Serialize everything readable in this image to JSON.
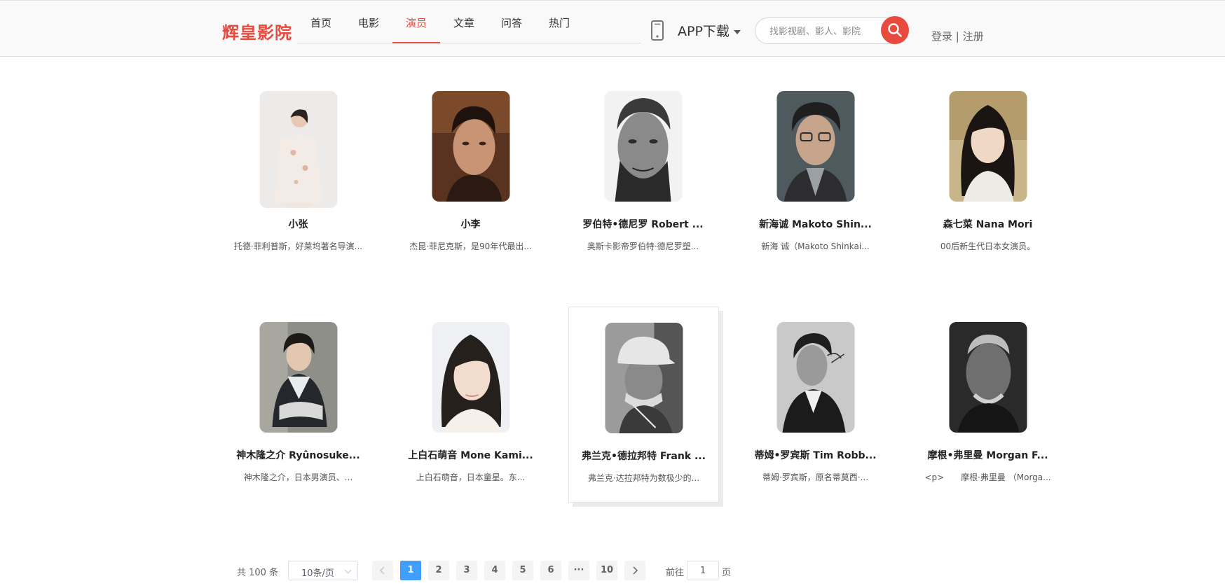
{
  "header": {
    "logo": "辉皇影院",
    "nav": [
      {
        "label": "首页",
        "active": false
      },
      {
        "label": "电影",
        "active": false
      },
      {
        "label": "演员",
        "active": true
      },
      {
        "label": "文章",
        "active": false
      },
      {
        "label": "问答",
        "active": false
      },
      {
        "label": "热门",
        "active": false
      }
    ],
    "app_download": "APP下载",
    "search_placeholder": "找影视剧、影人、影院",
    "login": "登录",
    "separator": "|",
    "register": "注册",
    "icons": {
      "phone": "phone-icon",
      "search": "search-icon",
      "dropdown": "caret-down-icon"
    },
    "accent_color": "#e84a3e"
  },
  "actors": [
    {
      "name": "小张",
      "desc": "托德·菲利普斯，好莱坞著名导演..."
    },
    {
      "name": "小李",
      "desc": "杰昆·菲尼克斯，是90年代最出..."
    },
    {
      "name": "罗伯特•德尼罗 Robert ...",
      "desc": "奥斯卡影帝罗伯特·德尼罗塑..."
    },
    {
      "name": "新海诚 Makoto Shin...",
      "desc": "新海 诚（Makoto Shinkai..."
    },
    {
      "name": "森七菜 Nana Mori",
      "desc": "00后新生代日本女演员。"
    },
    {
      "name": "神木隆之介 Ryûnosuke...",
      "desc": "神木隆之介，日本男演员、..."
    },
    {
      "name": "上白石萌音 Mone Kami...",
      "desc": "上白石萌音，日本童星。东..."
    },
    {
      "name": "弗兰克•德拉邦特 Frank ...",
      "desc": "弗兰克·达拉邦特为数极少的..."
    },
    {
      "name": "蒂姆•罗宾斯 Tim Robb...",
      "desc": "蒂姆·罗宾斯，原名蒂莫西·..."
    },
    {
      "name": "摩根•弗里曼 Morgan F...",
      "desc": "<p>　　摩根·弗里曼 （Morga..."
    }
  ],
  "pagination": {
    "total": "共 100 条",
    "page_size": "10条/页",
    "pages": [
      "1",
      "2",
      "3",
      "4",
      "5",
      "6",
      "···",
      "10"
    ],
    "current": "1",
    "goto_label": "前往",
    "goto_value": "1",
    "page_unit": "页",
    "active_color": "#409eff"
  }
}
